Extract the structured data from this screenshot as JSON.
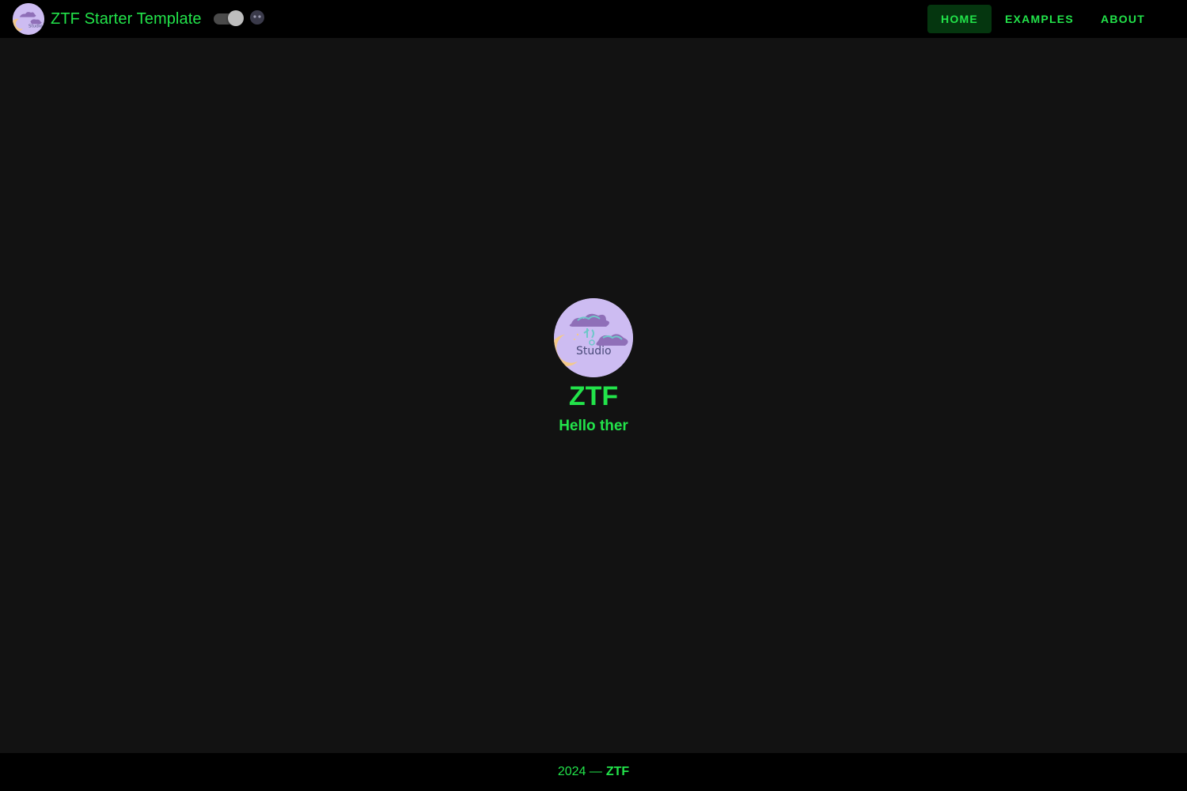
{
  "header": {
    "title": "ZTF Starter Template",
    "theme_toggle": {
      "state": "on",
      "mode_icon": "moon-icon"
    },
    "nav": [
      {
        "label": "HOME",
        "active": true
      },
      {
        "label": "EXAMPLES",
        "active": false
      },
      {
        "label": "ABOUT",
        "active": false
      }
    ]
  },
  "hero": {
    "logo_text": "Studio",
    "logo_icon": "studio-logo-icon",
    "title": "ZTF",
    "subtitle": "Hello ther"
  },
  "footer": {
    "year": "2024 —",
    "brand": "ZTF"
  },
  "colors": {
    "accent": "#22e34a",
    "header_bg": "#000000",
    "page_bg": "#121212",
    "active_nav_bg": "#05360f",
    "logo_bg": "#cdbcf2"
  }
}
